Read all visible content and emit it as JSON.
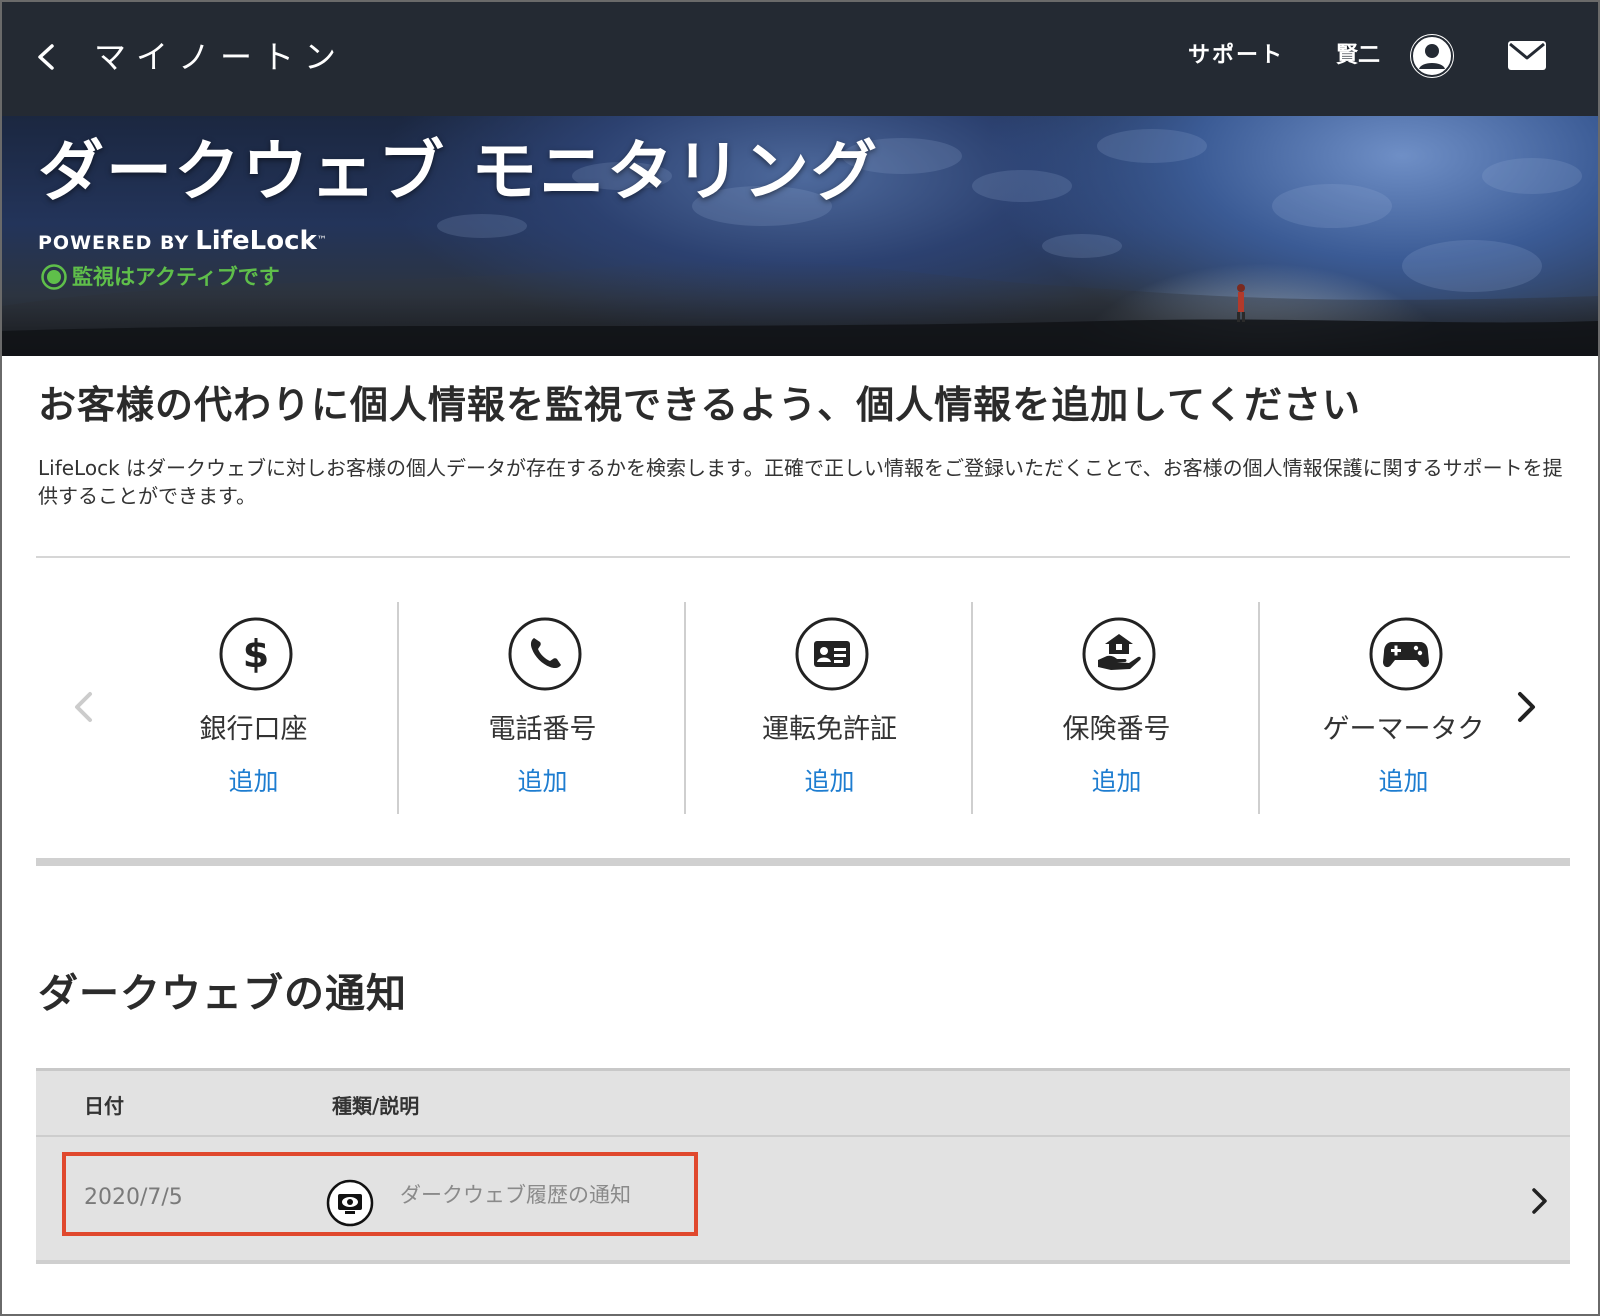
{
  "topbar": {
    "title": "マイノートン",
    "support": "サポート",
    "user_name": "賢二"
  },
  "hero": {
    "title": "ダークウェブ モニタリング",
    "powered_by": "POWERED BY",
    "brand": "LifeLock",
    "trademark": "™",
    "status": "監視はアクティブです"
  },
  "intro": {
    "heading": "お客様の代わりに個人情報を監視できるよう、個人情報を追加してください",
    "text": "LifeLock はダークウェブに対しお客様の個人データが存在するかを検索します。正確で正しい情報をご登録いただくことで、お客様の個人情報保護に関するサポートを提供することができます。"
  },
  "carousel": {
    "items": [
      {
        "icon": "dollar-icon",
        "label": "銀行口座",
        "action": "追加"
      },
      {
        "icon": "phone-icon",
        "label": "電話番号",
        "action": "追加"
      },
      {
        "icon": "id-card-icon",
        "label": "運転免許証",
        "action": "追加"
      },
      {
        "icon": "insurance-hand-icon",
        "label": "保険番号",
        "action": "追加"
      },
      {
        "icon": "gamepad-icon",
        "label": "ゲーマータク",
        "action": "追加"
      }
    ]
  },
  "notifications": {
    "heading": "ダークウェブの通知",
    "columns": {
      "date": "日付",
      "type": "種類/説明"
    },
    "rows": [
      {
        "date": "2020/7/5",
        "icon": "eye-monitor-icon",
        "description": "ダークウェブ履歴の通知"
      }
    ]
  },
  "colors": {
    "topbar": "#242a33",
    "accent_link": "#1e7dd0",
    "status_green": "#5fbf4a",
    "highlight": "#e0482d"
  }
}
